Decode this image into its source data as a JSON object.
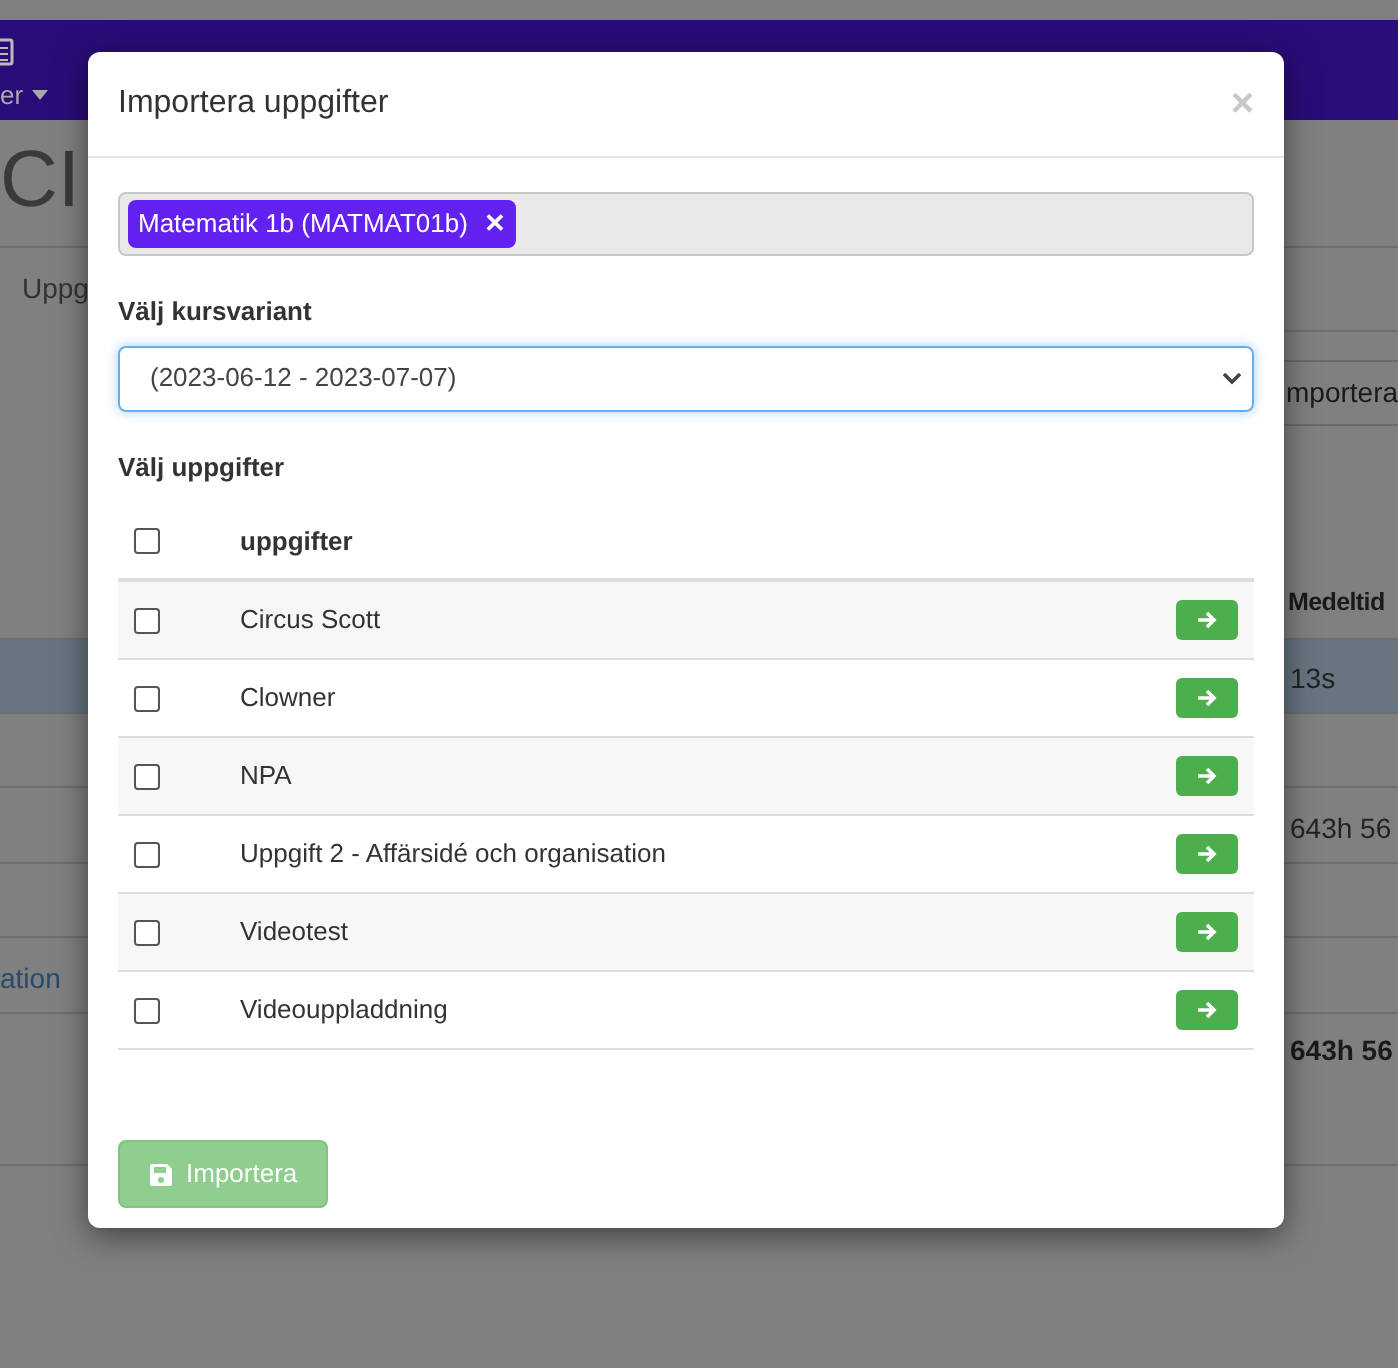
{
  "background": {
    "nav_label": "er",
    "heading": "CI",
    "tab": "Uppg",
    "import_button": "mportera",
    "column": "Medeltid",
    "rows": [
      {
        "left": "",
        "right": "13s",
        "selected": true
      },
      {
        "left": "",
        "right": "",
        "selected": false
      },
      {
        "left": "",
        "right": "643h 56",
        "selected": false
      },
      {
        "left": "",
        "right": "",
        "selected": false
      },
      {
        "left": "ation",
        "right": "",
        "selected": false
      }
    ],
    "total": "643h 56"
  },
  "dialog": {
    "title": "Importera uppgifter",
    "close": "×",
    "course_tags": [
      {
        "label": "Matematik 1b (MATMAT01b)",
        "remove": "✕"
      }
    ],
    "variant_label": "Välj kursvariant",
    "variant_value": "(2023-06-12 - 2023-07-07)",
    "tasks_label": "Välj uppgifter",
    "table": {
      "header": "uppgifter",
      "all_checked": false,
      "rows": [
        {
          "name": "Circus Scott",
          "checked": false
        },
        {
          "name": "Clowner",
          "checked": false
        },
        {
          "name": "NPA",
          "checked": false
        },
        {
          "name": "Uppgift 2 - Affärsidé och organisation",
          "checked": false
        },
        {
          "name": "Videotest",
          "checked": false
        },
        {
          "name": "Videouppladdning",
          "checked": false
        }
      ]
    },
    "import_button": {
      "label": "Importera",
      "disabled": true
    }
  }
}
